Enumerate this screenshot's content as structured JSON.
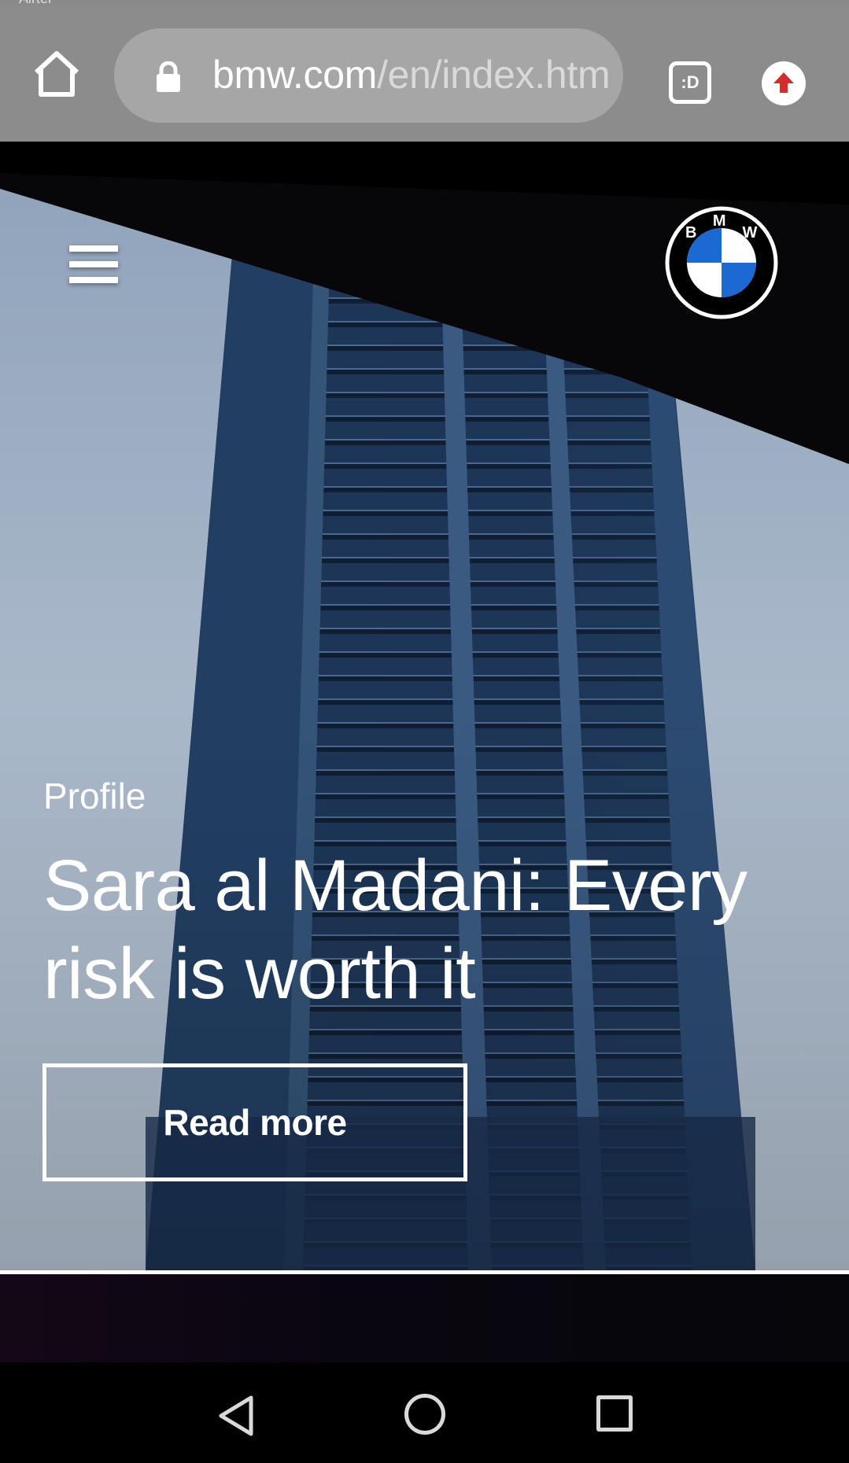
{
  "status_bar": {
    "carrier": "Airtel"
  },
  "browser": {
    "url_host": "bmw.com",
    "url_path": "/en/index.htm",
    "tab_badge": ":D",
    "icons": {
      "home": "home-icon",
      "lock": "lock-icon",
      "update": "arrow-up-icon"
    },
    "colors": {
      "chrome": "#8c8c8c",
      "urlbar": "#a6a6a6",
      "update_arrow": "#d62b2b"
    }
  },
  "hero": {
    "logo_letters": "BMW",
    "kicker": "Profile",
    "headline": "Sara al Madani: Every risk is worth it",
    "cta_label": "Read more"
  },
  "colors": {
    "bmw_blue": "#1c69d4",
    "text": "#ffffff"
  },
  "nav": {
    "icons": [
      "back-icon",
      "home-circle-icon",
      "recents-icon"
    ]
  }
}
